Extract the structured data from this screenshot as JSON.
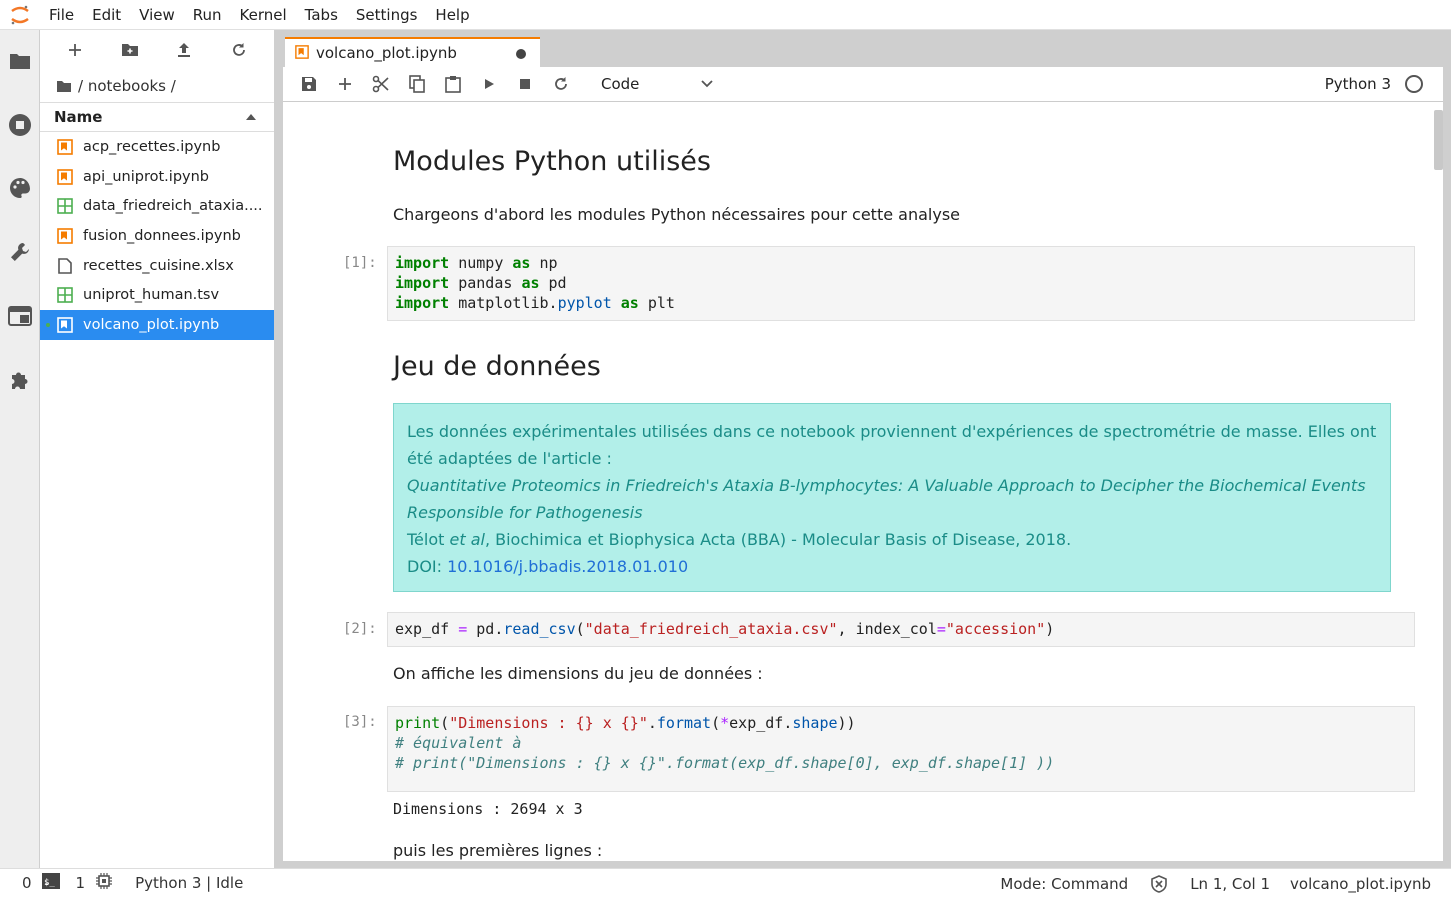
{
  "menubar": {
    "items": [
      "File",
      "Edit",
      "View",
      "Run",
      "Kernel",
      "Tabs",
      "Settings",
      "Help"
    ]
  },
  "filebrowser": {
    "breadcrumb": "/ notebooks /",
    "column_header": "Name",
    "files": [
      {
        "name": "acp_recettes.ipynb",
        "icon": "notebook-icon"
      },
      {
        "name": "api_uniprot.ipynb",
        "icon": "notebook-icon"
      },
      {
        "name": "data_friedreich_ataxia....",
        "icon": "table-icon"
      },
      {
        "name": "fusion_donnees.ipynb",
        "icon": "notebook-icon"
      },
      {
        "name": "recettes_cuisine.xlsx",
        "icon": "file-icon"
      },
      {
        "name": "uniprot_human.tsv",
        "icon": "table-icon"
      },
      {
        "name": "volcano_plot.ipynb",
        "icon": "notebook-icon",
        "selected": true
      }
    ]
  },
  "tab": {
    "title": "volcano_plot.ipynb"
  },
  "toolbar": {
    "cell_type": "Code",
    "kernel": "Python 3"
  },
  "notebook": {
    "h_modules": "Modules Python utilisés",
    "p_modules": "Chargeons d'abord les modules Python nécessaires pour cette analyse",
    "prompt1": "[1]:",
    "h_data": "Jeu de données",
    "info": {
      "line1": "Les données expérimentales utilisées dans ce notebook proviennent d'expériences de spectrométrie de masse. Elles ont été adaptées de l'article :",
      "article_title": "Quantitative Proteomics in Friedreich's Ataxia B-lymphocytes: A Valuable Approach to Decipher the Biochemical Events Responsible for Pathogenesis",
      "author": "Télot",
      "et_al": "et al",
      "journal": ", Biochimica et Biophysica Acta (BBA) - Molecular Basis of Disease, 2018.",
      "doi_label": "DOI: ",
      "doi": "10.1016/j.bbadis.2018.01.010"
    },
    "prompt2": "[2]:",
    "p_dims": "On affiche les dimensions du jeu de données :",
    "prompt3": "[3]:",
    "output3": "Dimensions : 2694 x 3",
    "p_first": "puis les premières lignes :"
  },
  "statusbar": {
    "terminals": "0",
    "kernels": "1",
    "kernel_status": "Python 3 | Idle",
    "mode": "Mode: Command",
    "position": "Ln 1, Col 1",
    "filename": "volcano_plot.ipynb"
  },
  "colors": {
    "accent": "#f57c00",
    "selection": "#2a8cf0",
    "info_bg": "#b2efe9"
  }
}
